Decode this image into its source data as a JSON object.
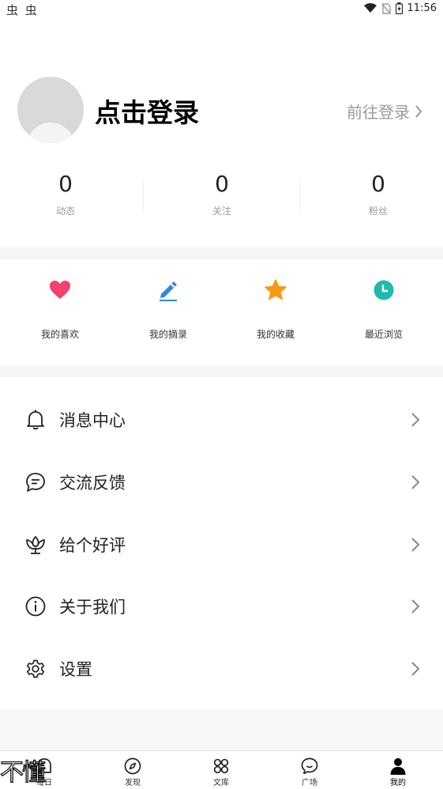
{
  "status_bar": {
    "left_icons": "虫 虫",
    "time": "11:56"
  },
  "profile": {
    "login_title": "点击登录",
    "goto_login": "前往登录"
  },
  "stats": [
    {
      "value": "0",
      "label": "动态"
    },
    {
      "value": "0",
      "label": "关注"
    },
    {
      "value": "0",
      "label": "粉丝"
    }
  ],
  "actions": [
    {
      "label": "我的喜欢",
      "icon": "heart-icon",
      "color": "#f5426a"
    },
    {
      "label": "我的摘录",
      "icon": "pencil-icon",
      "color": "#2f86e8"
    },
    {
      "label": "我的收藏",
      "icon": "star-icon",
      "color": "#f59a12"
    },
    {
      "label": "最近浏览",
      "icon": "clock-icon",
      "color": "#21b8ad"
    }
  ],
  "menu": [
    {
      "label": "消息中心",
      "icon": "bell-icon"
    },
    {
      "label": "交流反馈",
      "icon": "chat-bubble-icon"
    },
    {
      "label": "给个好评",
      "icon": "flower-icon"
    },
    {
      "label": "关于我们",
      "icon": "info-icon"
    },
    {
      "label": "设置",
      "icon": "gear-icon"
    }
  ],
  "bottom_nav": [
    {
      "label": "每日",
      "icon": "daily-icon",
      "active": false
    },
    {
      "label": "发现",
      "icon": "compass-icon",
      "active": false
    },
    {
      "label": "文库",
      "icon": "grid-icon",
      "active": false
    },
    {
      "label": "广场",
      "icon": "chat-smile-icon",
      "active": false
    },
    {
      "label": "我的",
      "icon": "person-icon",
      "active": true
    }
  ],
  "overlay_text": "不懂"
}
